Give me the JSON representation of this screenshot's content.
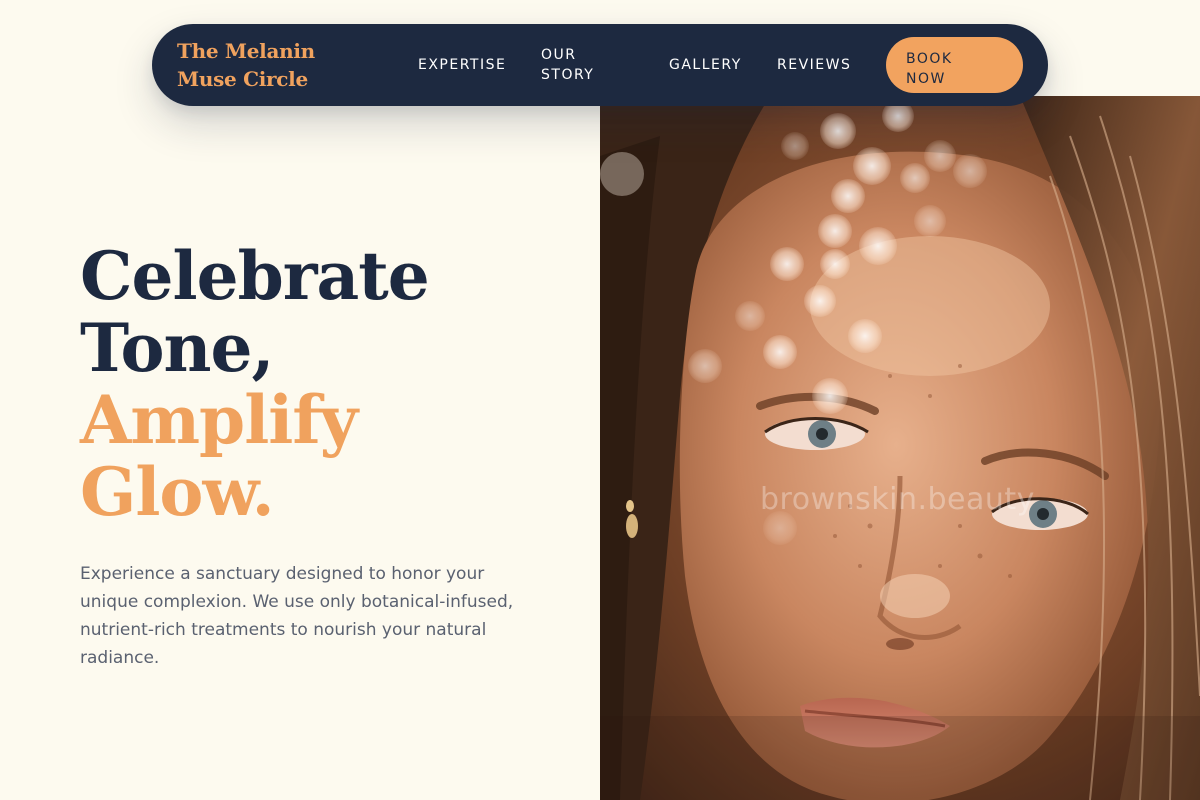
{
  "brand": {
    "name": "The Melanin Muse Circle"
  },
  "nav": {
    "links": [
      {
        "label": "EXPERTISE"
      },
      {
        "label": "OUR STORY"
      },
      {
        "label": "GALLERY"
      },
      {
        "label": "REVIEWS"
      }
    ],
    "cta_label": "BOOK NOW"
  },
  "hero": {
    "headline_line1": "Celebrate",
    "headline_line2": "Tone,",
    "headline_line3": "Amplify",
    "headline_line4": "Glow.",
    "body": "Experience a sanctuary designed to honor your unique complexion. We use only botanical-infused, nutrient-rich treatments to nourish your natural radiance.",
    "image_watermark": "brownskin.beauty",
    "image_icon": "portrait-photo-icon"
  },
  "colors": {
    "background": "#fdfaef",
    "navy": "#1d2940",
    "accent": "#f0a25e",
    "body_text": "#5a6170"
  }
}
